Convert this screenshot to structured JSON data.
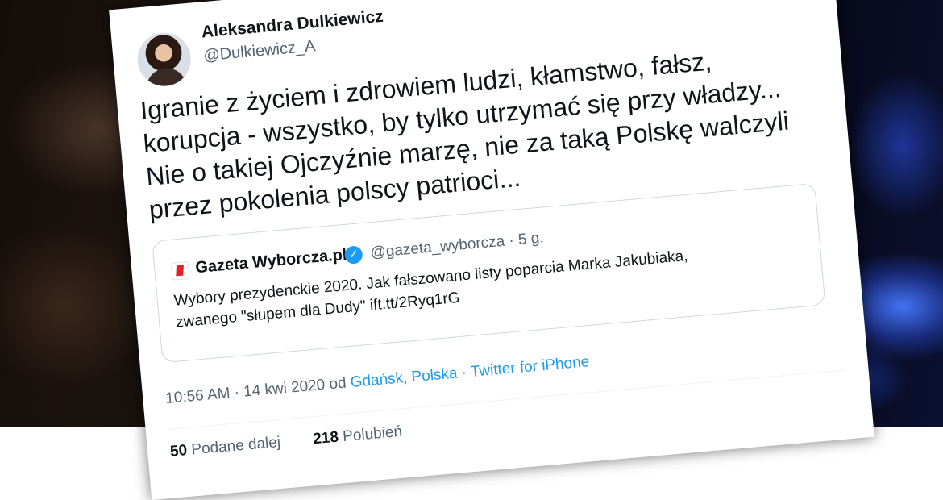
{
  "tweet": {
    "author_name": "Aleksandra Dulkiewicz",
    "author_handle": "@Dulkiewicz_A",
    "text": "Igranie z życiem i zdrowiem ludzi, kłamstwo, fałsz,\nkorupcja - wszystko, by tylko utrzymać się przy władzy...\nNie o takiej Ojczyźnie marzę, nie za taką Polskę walczyli\nprzez pokolenia polscy patrioci...",
    "timestamp": "10:56 AM · 14 kwi 2020 od",
    "location": "Gdańsk, Polska",
    "separator": "·",
    "source": "Twitter for iPhone",
    "retweets_count": "50",
    "retweets_label": "Podane dalej",
    "likes_count": "218",
    "likes_label": "Polubień"
  },
  "quoted": {
    "name": "Gazeta Wyborcza.pl",
    "handle_time": "@gazeta_wyborcza · 5 g.",
    "text": "Wybory prezydenckie 2020. Jak fałszowano listy poparcia Marka Jakubiaka,\nzwanego \"słupem dla Dudy\" ift.tt/2Ryq1rG",
    "verified_icon": "✓"
  },
  "colors": {
    "accent": "#1d9bf0",
    "text": "#0f1419",
    "secondary": "#536471",
    "logo_red": "#e2202a"
  },
  "icons": [
    "avatar",
    "gazeta-logo-icon",
    "verified-badge-icon"
  ]
}
